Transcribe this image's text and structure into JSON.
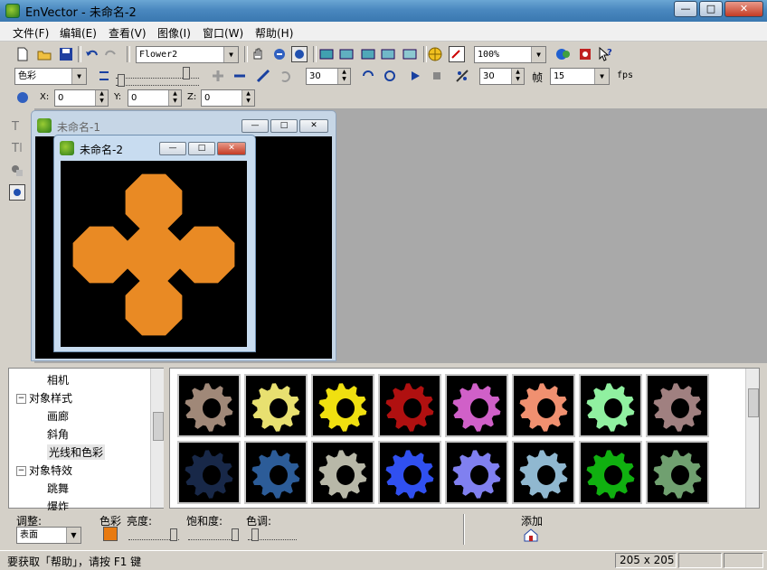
{
  "window": {
    "title": "EnVector - 未命名-2",
    "min_label": "—",
    "max_label": "□",
    "close_label": "✕"
  },
  "menu": [
    "文件(F)",
    "编辑(E)",
    "查看(V)",
    "图像(I)",
    "窗口(W)",
    "帮助(H)"
  ],
  "toolbar1": {
    "shape_value": "Flower2",
    "zoom_value": "100%"
  },
  "toolbar2": {
    "mode_value": "色彩",
    "spin1": "30",
    "spin2": "30",
    "frame_label": "帧",
    "fps_value": "15",
    "fps_label": "fps"
  },
  "toolbar3": {
    "x_label": "X:",
    "x_value": "0",
    "y_label": "Y:",
    "y_value": "0",
    "z_label": "Z:",
    "z_value": "0"
  },
  "documents": [
    {
      "title": "未命名-1"
    },
    {
      "title": "未命名-2"
    }
  ],
  "colors": {
    "shape": "#e98a24",
    "canvas": "#000000",
    "accent": "#e87a10"
  },
  "tree": [
    {
      "label": "相机",
      "level": 2
    },
    {
      "label": "对象样式",
      "level": 1,
      "expander": "−"
    },
    {
      "label": "画廊",
      "level": 2
    },
    {
      "label": "斜角",
      "level": 2
    },
    {
      "label": "光线和色彩",
      "level": 2,
      "selected": true
    },
    {
      "label": "对象特效",
      "level": 1,
      "expander": "−"
    },
    {
      "label": "跳舞",
      "level": 2
    },
    {
      "label": "爆炸",
      "level": 2
    }
  ],
  "gallery": [
    {
      "name": "gear-bronze",
      "color": "#a08878"
    },
    {
      "name": "gear-pale-yellow",
      "color": "#e8e070"
    },
    {
      "name": "gear-yellow",
      "color": "#f0e010"
    },
    {
      "name": "gear-red",
      "color": "#b01010"
    },
    {
      "name": "gear-magenta",
      "color": "#d060c8"
    },
    {
      "name": "gear-salmon",
      "color": "#f09070"
    },
    {
      "name": "gear-mint",
      "color": "#90f0a0"
    },
    {
      "name": "gear-grey-red",
      "color": "#a08080"
    },
    {
      "name": "gear-navy",
      "color": "#182848"
    },
    {
      "name": "gear-steel-blue",
      "color": "#2c5c98"
    },
    {
      "name": "gear-silver",
      "color": "#b8b8a8"
    },
    {
      "name": "gear-blue",
      "color": "#3050f0"
    },
    {
      "name": "gear-periwinkle",
      "color": "#8080f0"
    },
    {
      "name": "gear-light-blue",
      "color": "#90b8d0"
    },
    {
      "name": "gear-green",
      "color": "#10b010"
    },
    {
      "name": "gear-sage",
      "color": "#70a070"
    }
  ],
  "adjust": {
    "label": "调整:",
    "target_value": "表面",
    "color_label": "色彩",
    "brightness_label": "亮度:",
    "saturation_label": "饱和度:",
    "hue_label": "色调:",
    "add_label": "添加"
  },
  "status": {
    "message": "要获取「帮助」，请按 F1 键",
    "size": "205 x 205"
  }
}
